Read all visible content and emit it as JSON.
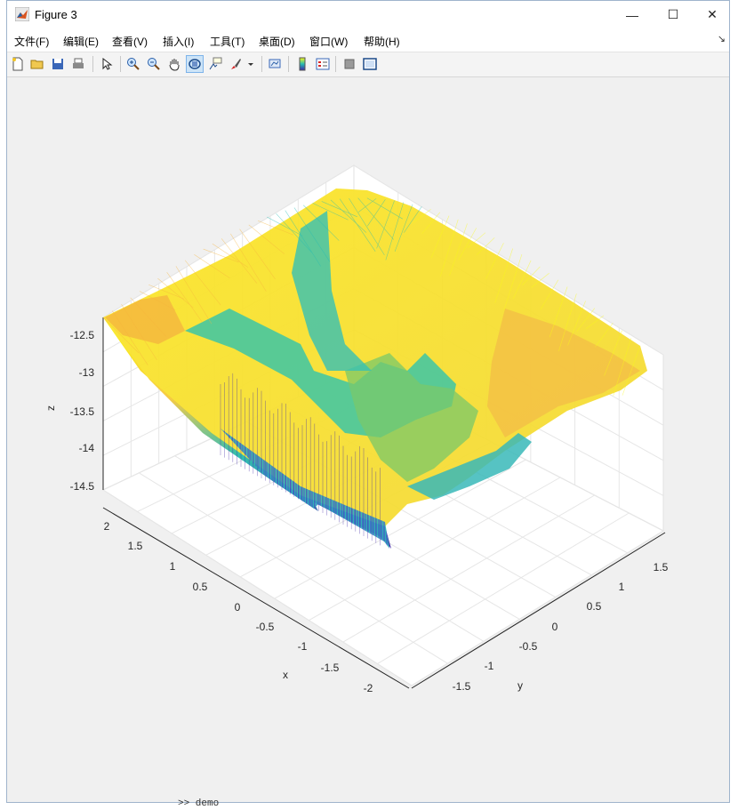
{
  "window": {
    "title": "Figure 3"
  },
  "window_controls": {
    "minimize": "—",
    "maximize": "☐",
    "close": "✕"
  },
  "menu": [
    {
      "label": "文件(F)"
    },
    {
      "label": "编辑(E)"
    },
    {
      "label": "查看(V)"
    },
    {
      "label": "插入(I)"
    },
    {
      "label": "工具(T)"
    },
    {
      "label": "桌面(D)"
    },
    {
      "label": "窗口(W)"
    },
    {
      "label": "帮助(H)"
    }
  ],
  "menu_overflow": "↘",
  "toolbar": [
    {
      "name": "new-figure-icon"
    },
    {
      "name": "open-file-icon"
    },
    {
      "name": "save-icon"
    },
    {
      "name": "print-icon"
    },
    {
      "name": "edit-plot-arrow-icon"
    },
    {
      "name": "zoom-in-icon"
    },
    {
      "name": "zoom-out-icon"
    },
    {
      "name": "pan-hand-icon"
    },
    {
      "name": "rotate-3d-icon",
      "active": true
    },
    {
      "name": "data-cursor-icon"
    },
    {
      "name": "brush-icon"
    },
    {
      "name": "link-plot-icon"
    },
    {
      "name": "colorbar-icon"
    },
    {
      "name": "legend-icon"
    },
    {
      "name": "hide-plot-tools-icon"
    },
    {
      "name": "show-plot-tools-icon"
    }
  ],
  "chart_data": {
    "type": "surface",
    "zlabel": "z",
    "xlabel": "x",
    "ylabel": "y",
    "z_ticks": [
      "-12.5",
      "-13",
      "-13.5",
      "-14",
      "-14.5"
    ],
    "x_ticks": [
      "2",
      "1.5",
      "1",
      "0.5",
      "0",
      "-0.5",
      "-1",
      "-1.5",
      "-2"
    ],
    "y_ticks": [
      "1.5",
      "1",
      "0.5",
      "0",
      "-0.5",
      "-1",
      "-1.5"
    ],
    "zlim": [
      -14.7,
      -12.3
    ],
    "xlim": [
      -2.2,
      2.2
    ],
    "ylim": [
      -1.8,
      1.8
    ],
    "grid": true,
    "colormap": "parula",
    "colors": {
      "low": "#3e26a8",
      "mid": "#26bcb3",
      "high": "#f9fb15",
      "orange": "#f6b43c"
    }
  },
  "console": {
    "command": ">> demo"
  }
}
